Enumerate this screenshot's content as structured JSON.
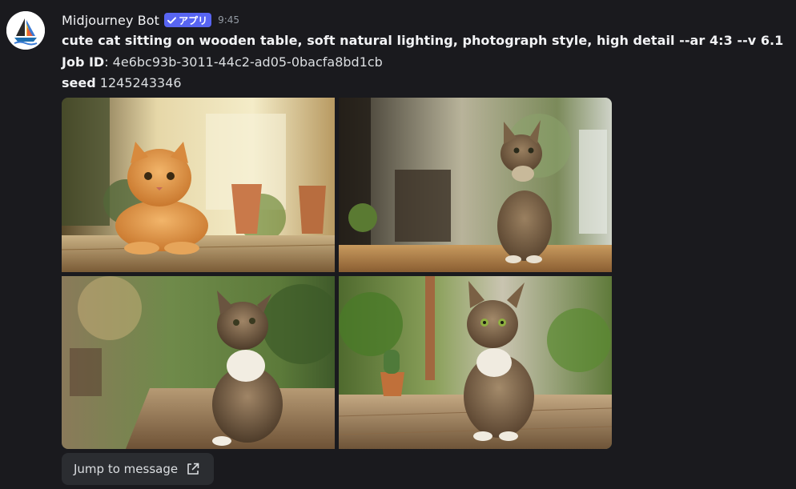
{
  "message": {
    "author": "Midjourney Bot",
    "badge": "アプリ",
    "timestamp": "9:45",
    "prompt": "cute cat sitting on wooden table, soft natural lighting, photograph style, high detail --ar 4:3 --v 6.1",
    "job_id_label": "Job ID",
    "job_id_value": ": 4e6bc93b-3011-44c2-ad05-0bacfa8bd1cb",
    "seed_label": "seed",
    "seed_value": " 1245243346",
    "jump_label": "Jump to message"
  },
  "images": [
    {
      "subject": "orange tabby cat lying on wooden table, potted plants, sunny window"
    },
    {
      "subject": "tabby cat sitting on wooden table looking up, blurred cafe background"
    },
    {
      "subject": "tabby cat with white chest looking up, blurred garden background"
    },
    {
      "subject": "tabby cat with green eyes sitting on wooden table, small cactus pot"
    }
  ],
  "colors": {
    "background": "#1a1a1e",
    "badge": "#5865f2",
    "button": "#2b2d31",
    "timestamp": "#949ba4"
  },
  "icons": [
    "midjourney-sailboat-icon",
    "verified-check-icon",
    "external-link-icon"
  ]
}
